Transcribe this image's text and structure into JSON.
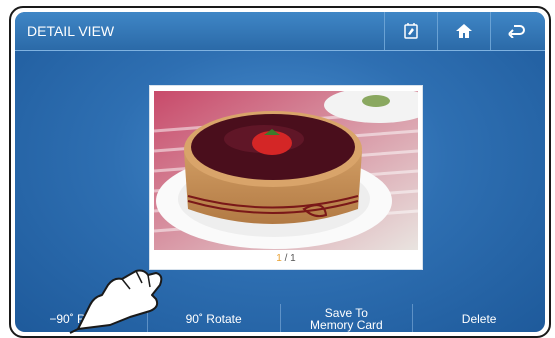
{
  "header": {
    "title": "DETAIL VIEW",
    "buttons": [
      {
        "name": "edit-icon"
      },
      {
        "name": "home-icon"
      },
      {
        "name": "back-icon"
      }
    ]
  },
  "photo": {
    "counter_current": "1",
    "counter_total": "/ 1"
  },
  "toolbar": {
    "rotate_left_label": "−90˚ Rotate",
    "rotate_right_label": "90˚ Rotate",
    "save_label_line1": "Save To",
    "save_label_line2": "Memory Card",
    "delete_label": "Delete"
  },
  "colors": {
    "accent": "#e8a030",
    "header": "#2b6aa8",
    "background": "#2e6fb2"
  }
}
